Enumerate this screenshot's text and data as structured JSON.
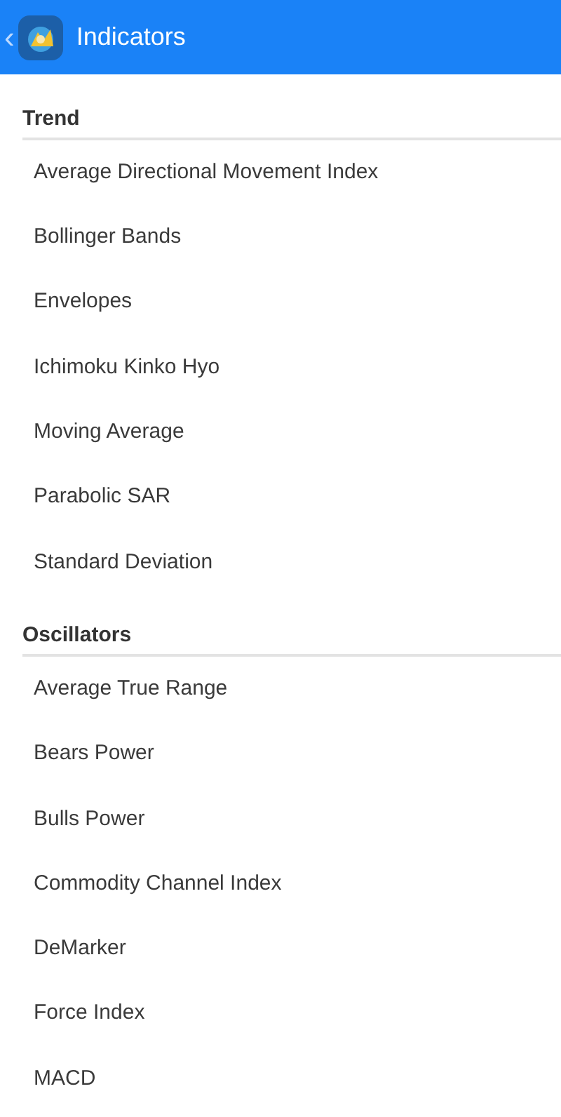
{
  "header": {
    "back": "‹",
    "title": "Indicators"
  },
  "sections": [
    {
      "title": "Trend",
      "items": [
        "Average Directional Movement Index",
        "Bollinger Bands",
        "Envelopes",
        "Ichimoku Kinko Hyo",
        "Moving Average",
        "Parabolic SAR",
        "Standard Deviation"
      ]
    },
    {
      "title": "Oscillators",
      "items": [
        "Average True Range",
        "Bears Power",
        "Bulls Power",
        "Commodity Channel Index",
        "DeMarker",
        "Force Index",
        "MACD"
      ]
    }
  ]
}
